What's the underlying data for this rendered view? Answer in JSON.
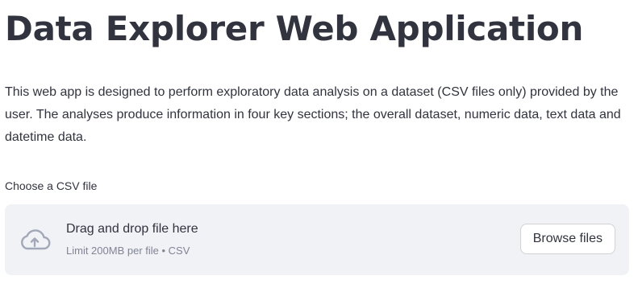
{
  "header": {
    "title": "Data Explorer Web Application"
  },
  "intro": {
    "text": "This web app is designed to perform exploratory data analysis on a dataset (CSV files only) provided by the user. The analyses produce information in four key sections; the overall dataset, numeric data, text data and datetime data."
  },
  "uploader": {
    "label": "Choose a CSV file",
    "instruction": "Drag and drop file here",
    "limit_text": "Limit 200MB per file • CSV",
    "browse_label": "Browse files",
    "icon": "cloud-upload-icon"
  },
  "colors": {
    "text": "#31333f",
    "muted": "#808495",
    "dropzone_bg": "#f0f2f6",
    "icon": "#a3a8b8"
  }
}
